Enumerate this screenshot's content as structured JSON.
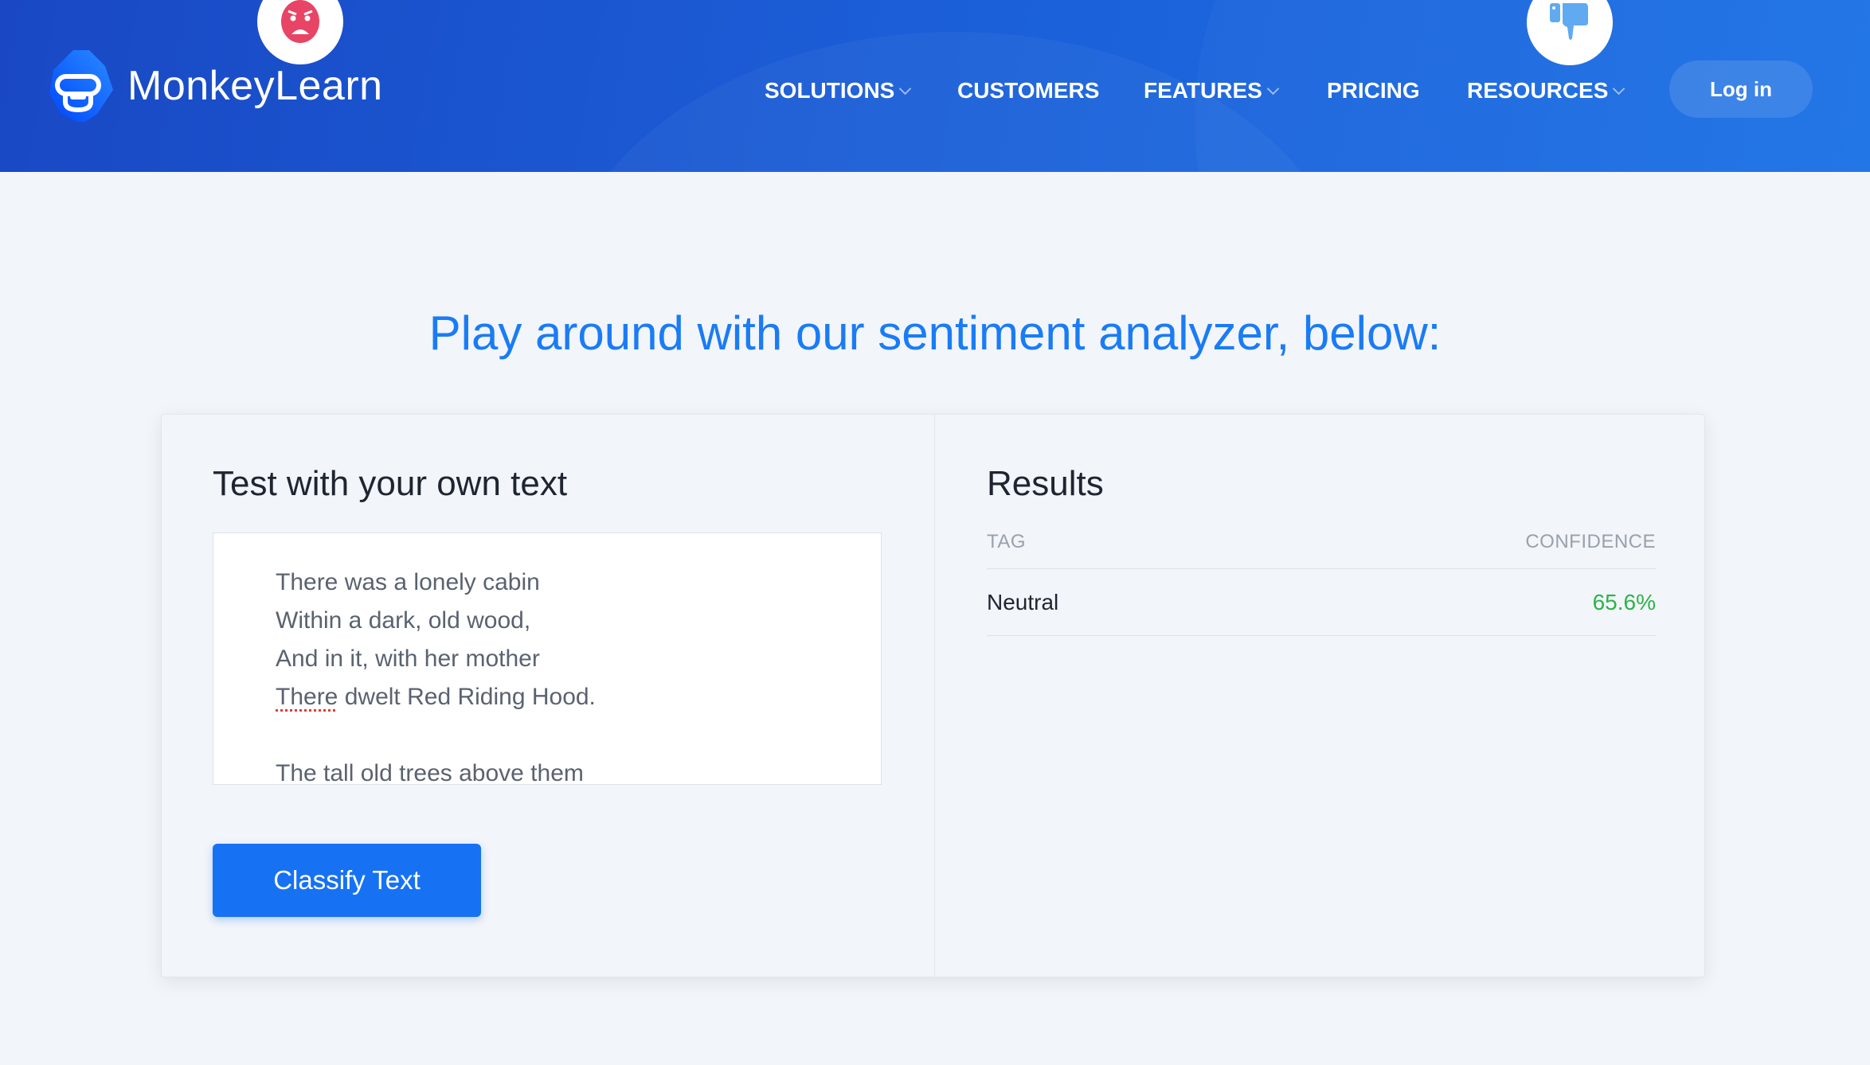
{
  "header": {
    "brand": "MonkeyLearn",
    "nav": [
      {
        "label": "SOLUTIONS",
        "dropdown": true
      },
      {
        "label": "CUSTOMERS",
        "dropdown": false
      },
      {
        "label": "FEATURES",
        "dropdown": true
      },
      {
        "label": "PRICING",
        "dropdown": false
      },
      {
        "label": "RESOURCES",
        "dropdown": true
      }
    ],
    "login_label": "Log in",
    "decor_icons": [
      "angry-face-icon",
      "thumbs-down-icon"
    ]
  },
  "main": {
    "heading": "Play around with our sentiment analyzer, below:",
    "input_panel": {
      "title": "Test with your own text",
      "text_lines": [
        "There was a lonely cabin",
        "Within a dark, old wood,",
        "And in it, with her mother",
        "dwelt Red Riding Hood.",
        "",
        "The tall old trees above them"
      ],
      "misspelled_word": "There",
      "button_label": "Classify Text"
    },
    "results_panel": {
      "title": "Results",
      "columns": [
        "TAG",
        "CONFIDENCE"
      ],
      "rows": [
        {
          "tag": "Neutral",
          "confidence": "65.6%"
        }
      ]
    }
  },
  "colors": {
    "accent": "#1a7cf5",
    "button": "#1672f3",
    "confidence": "#2bb34a",
    "header": "#1b5fd8"
  }
}
